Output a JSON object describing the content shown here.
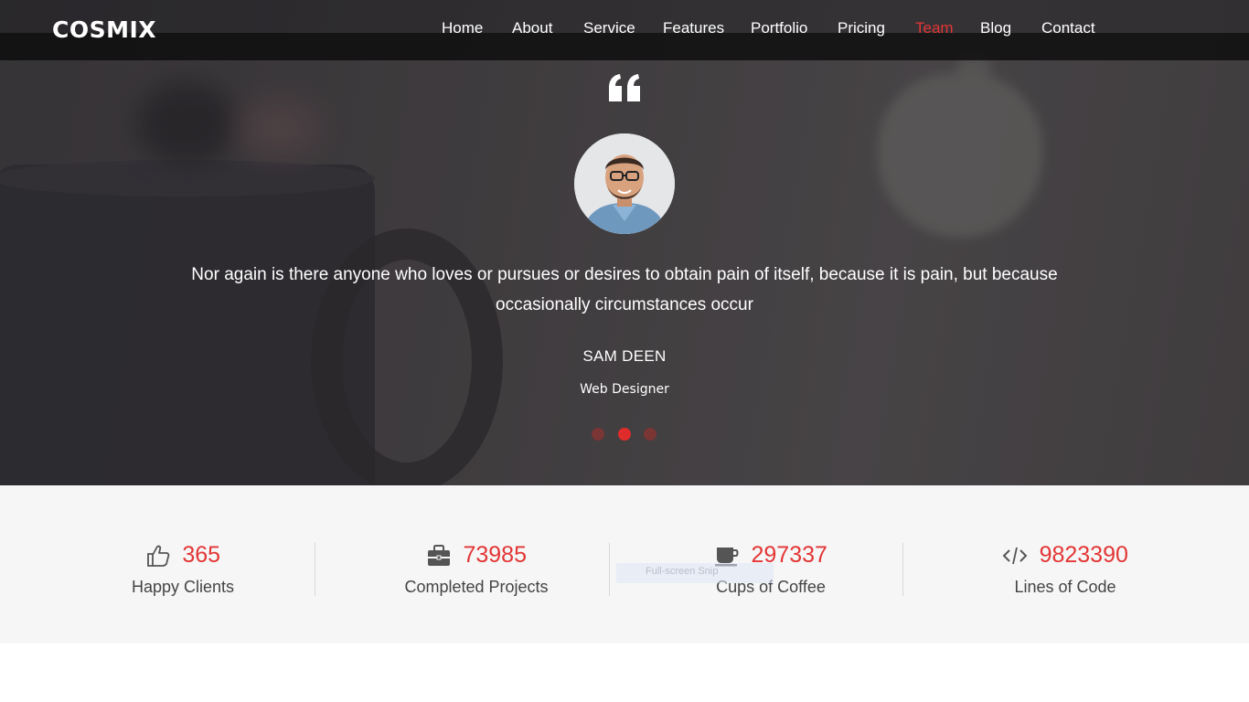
{
  "header": {
    "logo": "COSMIX",
    "nav": [
      {
        "label": "Home",
        "active": false
      },
      {
        "label": "About",
        "active": false
      },
      {
        "label": "Service",
        "active": false
      },
      {
        "label": "Features",
        "active": false
      },
      {
        "label": "Portfolio",
        "active": false
      },
      {
        "label": "Pricing",
        "active": false
      },
      {
        "label": "Team",
        "active": true
      },
      {
        "label": "Blog",
        "active": false
      },
      {
        "label": "Contact",
        "active": false
      }
    ]
  },
  "testimonial": {
    "quote_icon": "quote-left-icon",
    "quote_line1": "Nor again is there anyone who loves or pursues or desires to obtain pain of itself, because it is pain, but because",
    "quote_line2": "occasionally circumstances occur",
    "author_name": "SAM DEEN",
    "author_role": "Web Designer",
    "slides": {
      "count": 3,
      "active_index": 1
    }
  },
  "counters": [
    {
      "icon": "thumbs-up-icon",
      "value": "365",
      "label": "Happy Clients"
    },
    {
      "icon": "briefcase-icon",
      "value": "73985",
      "label": "Completed Projects"
    },
    {
      "icon": "coffee-cup-icon",
      "value": "297337",
      "label": "Cups of Coffee"
    },
    {
      "icon": "code-icon",
      "value": "9823390",
      "label": "Lines of Code"
    }
  ],
  "overlay_tip": "Full-screen Snip",
  "colors": {
    "accent": "#e33535",
    "counter_bg": "#f6f6f6",
    "label_text": "#444444",
    "nav_text": "#ffffff"
  }
}
